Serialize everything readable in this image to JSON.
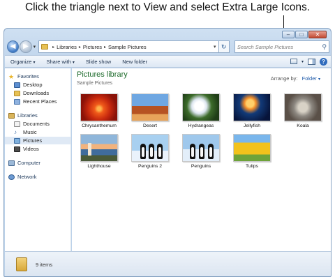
{
  "instruction": "Click the triangle next to View and select Extra Large Icons.",
  "window": {
    "buttons": {
      "minimize": "–",
      "maximize": "□",
      "close": "✕"
    }
  },
  "address_bar": {
    "back_glyph": "◀",
    "forward_glyph": "▶",
    "dropdown_glyph": "▾",
    "crumbs": [
      "Libraries",
      "Pictures",
      "Sample Pictures"
    ],
    "separator": "▸",
    "tail_caret": "▾",
    "refresh_glyph": "↻",
    "search_placeholder": "Search Sample Pictures",
    "search_icon": "search-icon"
  },
  "toolbar": {
    "organize": "Organize",
    "share_with": "Share with",
    "slide_show": "Slide show",
    "new_folder": "New folder",
    "caret": "▾",
    "help": "?"
  },
  "sidebar": {
    "favorites": {
      "label": "Favorites",
      "items": [
        "Desktop",
        "Downloads",
        "Recent Places"
      ]
    },
    "libraries": {
      "label": "Libraries",
      "items": [
        "Documents",
        "Music",
        "Pictures",
        "Videos"
      ],
      "selected": "Pictures"
    },
    "computer": "Computer",
    "network": "Network"
  },
  "main": {
    "title": "Pictures library",
    "subtitle": "Sample Pictures",
    "arrange_label": "Arrange by:",
    "arrange_value": "Folder",
    "files": [
      "Chrysanthemum",
      "Desert",
      "Hydrangeas",
      "Jellyfish",
      "Koala",
      "Lighthouse",
      "Penguins 2",
      "Penguins",
      "Tulips"
    ]
  },
  "details": {
    "item_count": "9 items"
  },
  "colors": {
    "library_title": "#1d6b2b",
    "link": "#1a57a8",
    "window_frame": "#bcd2ea"
  }
}
